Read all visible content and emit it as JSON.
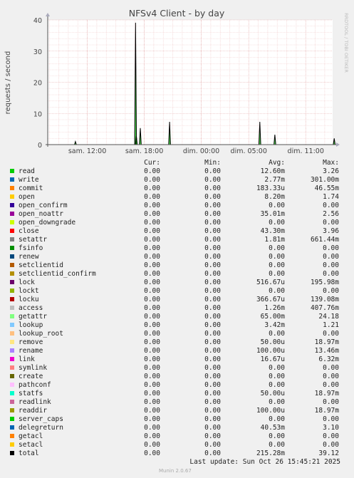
{
  "chart_data": {
    "type": "area",
    "title": "NFSv4 Client - by day",
    "ylabel": "requests / second",
    "watermark": "RRDTOOL / TOBI OETIKER",
    "ylim": [
      0,
      40
    ],
    "yticks": [
      0,
      10,
      20,
      30,
      40
    ],
    "xticks": [
      "sam. 12:00",
      "sam. 18:00",
      "dim. 00:00",
      "dim. 05:00",
      "dim. 11:00"
    ],
    "spikes": [
      {
        "x": "sam. 10:45",
        "value": 1.0
      },
      {
        "x": "sam. 17:05",
        "value": 39.1
      },
      {
        "x": "sam. 17:10",
        "value": 2.8
      },
      {
        "x": "sam. 17:35",
        "value": 5.3
      },
      {
        "x": "sam. 20:40",
        "value": 7.3
      },
      {
        "x": "dim. 06:10",
        "value": 7.3
      },
      {
        "x": "dim. 07:45",
        "value": 3.2
      },
      {
        "x": "dim. 14:00",
        "value": 2.0
      }
    ],
    "columns": [
      "Cur:",
      "Min:",
      "Avg:",
      "Max:"
    ],
    "series": [
      {
        "name": "read",
        "color": "#00cc00",
        "cur": "0.00",
        "min": "0.00",
        "avg": "12.60m",
        "max": "3.26"
      },
      {
        "name": "write",
        "color": "#0066b3",
        "cur": "0.00",
        "min": "0.00",
        "avg": "2.77m",
        "max": "301.00m"
      },
      {
        "name": "commit",
        "color": "#ff8000",
        "cur": "0.00",
        "min": "0.00",
        "avg": "183.33u",
        "max": "46.55m"
      },
      {
        "name": "open",
        "color": "#ffcc00",
        "cur": "0.00",
        "min": "0.00",
        "avg": "8.20m",
        "max": "1.74"
      },
      {
        "name": "open_confirm",
        "color": "#330099",
        "cur": "0.00",
        "min": "0.00",
        "avg": "0.00",
        "max": "0.00"
      },
      {
        "name": "open_noattr",
        "color": "#990099",
        "cur": "0.00",
        "min": "0.00",
        "avg": "35.01m",
        "max": "2.56"
      },
      {
        "name": "open_downgrade",
        "color": "#ccff00",
        "cur": "0.00",
        "min": "0.00",
        "avg": "0.00",
        "max": "0.00"
      },
      {
        "name": "close",
        "color": "#ff0000",
        "cur": "0.00",
        "min": "0.00",
        "avg": "43.30m",
        "max": "3.96"
      },
      {
        "name": "setattr",
        "color": "#808080",
        "cur": "0.00",
        "min": "0.00",
        "avg": "1.81m",
        "max": "661.44m"
      },
      {
        "name": "fsinfo",
        "color": "#008f00",
        "cur": "0.00",
        "min": "0.00",
        "avg": "0.00",
        "max": "0.00"
      },
      {
        "name": "renew",
        "color": "#00487d",
        "cur": "0.00",
        "min": "0.00",
        "avg": "0.00",
        "max": "0.00"
      },
      {
        "name": "setclientid",
        "color": "#b35a00",
        "cur": "0.00",
        "min": "0.00",
        "avg": "0.00",
        "max": "0.00"
      },
      {
        "name": "setclientid_confirm",
        "color": "#b38f00",
        "cur": "0.00",
        "min": "0.00",
        "avg": "0.00",
        "max": "0.00"
      },
      {
        "name": "lock",
        "color": "#6b006b",
        "cur": "0.00",
        "min": "0.00",
        "avg": "516.67u",
        "max": "195.98m"
      },
      {
        "name": "lockt",
        "color": "#8fb300",
        "cur": "0.00",
        "min": "0.00",
        "avg": "0.00",
        "max": "0.00"
      },
      {
        "name": "locku",
        "color": "#b30000",
        "cur": "0.00",
        "min": "0.00",
        "avg": "366.67u",
        "max": "139.08m"
      },
      {
        "name": "access",
        "color": "#bebebe",
        "cur": "0.00",
        "min": "0.00",
        "avg": "1.26m",
        "max": "407.76m"
      },
      {
        "name": "getattr",
        "color": "#80ff80",
        "cur": "0.00",
        "min": "0.00",
        "avg": "65.00m",
        "max": "24.18"
      },
      {
        "name": "lookup",
        "color": "#80c9ff",
        "cur": "0.00",
        "min": "0.00",
        "avg": "3.42m",
        "max": "1.21"
      },
      {
        "name": "lookup_root",
        "color": "#ffc080",
        "cur": "0.00",
        "min": "0.00",
        "avg": "0.00",
        "max": "0.00"
      },
      {
        "name": "remove",
        "color": "#ffe680",
        "cur": "0.00",
        "min": "0.00",
        "avg": "50.00u",
        "max": "18.97m"
      },
      {
        "name": "rename",
        "color": "#aa80ff",
        "cur": "0.00",
        "min": "0.00",
        "avg": "100.00u",
        "max": "13.46m"
      },
      {
        "name": "link",
        "color": "#ee00cc",
        "cur": "0.00",
        "min": "0.00",
        "avg": "16.67u",
        "max": "6.32m"
      },
      {
        "name": "symlink",
        "color": "#ff8080",
        "cur": "0.00",
        "min": "0.00",
        "avg": "0.00",
        "max": "0.00"
      },
      {
        "name": "create",
        "color": "#666600",
        "cur": "0.00",
        "min": "0.00",
        "avg": "0.00",
        "max": "0.00"
      },
      {
        "name": "pathconf",
        "color": "#ffbfff",
        "cur": "0.00",
        "min": "0.00",
        "avg": "0.00",
        "max": "0.00"
      },
      {
        "name": "statfs",
        "color": "#00ffcc",
        "cur": "0.00",
        "min": "0.00",
        "avg": "50.00u",
        "max": "18.97m"
      },
      {
        "name": "readlink",
        "color": "#cc6699",
        "cur": "0.00",
        "min": "0.00",
        "avg": "0.00",
        "max": "0.00"
      },
      {
        "name": "readdir",
        "color": "#999900",
        "cur": "0.00",
        "min": "0.00",
        "avg": "100.00u",
        "max": "18.97m"
      },
      {
        "name": "server_caps",
        "color": "#00cc00",
        "cur": "0.00",
        "min": "0.00",
        "avg": "0.00",
        "max": "0.00"
      },
      {
        "name": "delegreturn",
        "color": "#0066b3",
        "cur": "0.00",
        "min": "0.00",
        "avg": "40.53m",
        "max": "3.10"
      },
      {
        "name": "getacl",
        "color": "#ff8000",
        "cur": "0.00",
        "min": "0.00",
        "avg": "0.00",
        "max": "0.00"
      },
      {
        "name": "setacl",
        "color": "#ffcc00",
        "cur": "0.00",
        "min": "0.00",
        "avg": "0.00",
        "max": "0.00"
      },
      {
        "name": "total",
        "color": "#000000",
        "cur": "0.00",
        "min": "0.00",
        "avg": "215.28m",
        "max": "39.12"
      }
    ],
    "last_update": "Last update: Sun Oct 26 15:45:21 2025",
    "generator": "Munin 2.0.67"
  }
}
